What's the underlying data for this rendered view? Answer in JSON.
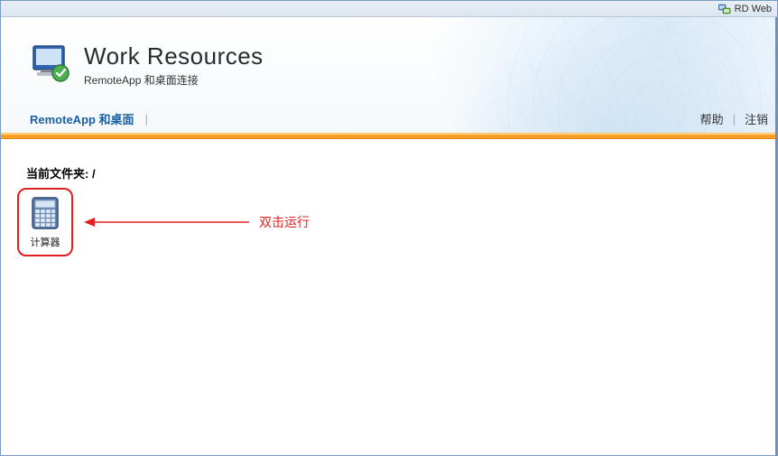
{
  "topbar": {
    "label": "RD Web"
  },
  "header": {
    "title": "Work Resources",
    "subtitle": "RemoteApp 和桌面连接"
  },
  "nav": {
    "left_link": "RemoteApp 和桌面",
    "help": "帮助",
    "logout": "注销"
  },
  "content": {
    "current_folder_label": "当前文件夹:",
    "current_folder_path": "/",
    "apps": [
      {
        "label": "计算器",
        "icon": "calculator-icon"
      }
    ]
  },
  "annotation": {
    "text": "双击运行"
  }
}
